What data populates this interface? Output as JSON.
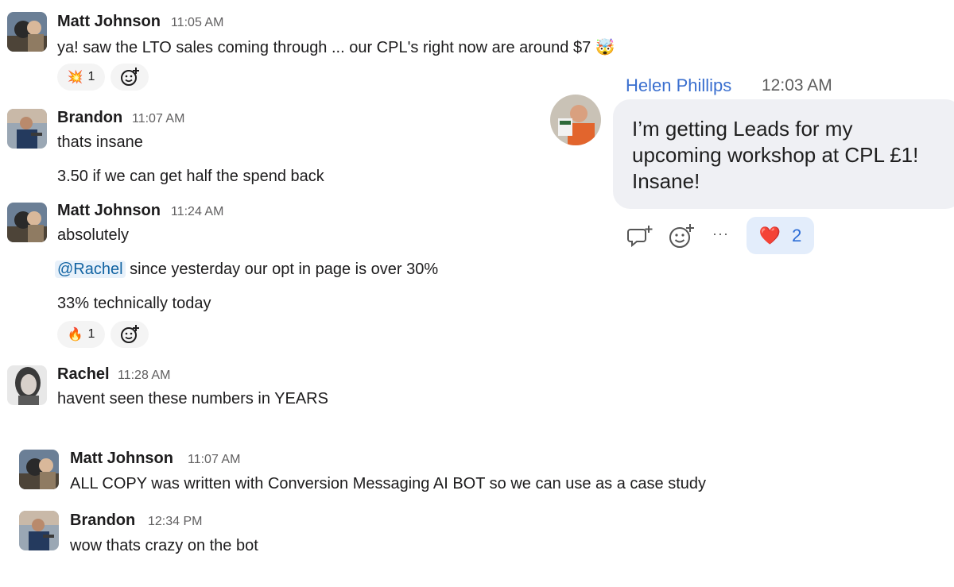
{
  "messages": [
    {
      "author": "Matt Johnson",
      "time": "11:05 AM",
      "lines": [
        "ya! saw the LTO sales coming through ... our CPL's right now are around $7"
      ],
      "reaction": {
        "emoji": "💥",
        "count": "1"
      }
    },
    {
      "author": "Brandon",
      "time": "11:07 AM",
      "lines": [
        "thats insane",
        "3.50 if we can get half the spend back"
      ]
    },
    {
      "author": "Matt Johnson",
      "time": "11:24 AM",
      "lines": [
        "absolutely",
        "since yesterday our opt in page is over 30%",
        "33% technically today"
      ],
      "mention": "@Rachel",
      "reaction": {
        "emoji": "🔥",
        "count": "1"
      }
    },
    {
      "author": "Rachel",
      "time": "11:28 AM",
      "lines": [
        "havent seen these numbers in YEARS"
      ]
    },
    {
      "author": "Matt Johnson",
      "time": "11:07 AM",
      "lines": [
        "ALL COPY was written with Conversion Messaging AI BOT so we can use as a case study"
      ]
    },
    {
      "author": "Brandon",
      "time": "12:34 PM",
      "lines": [
        "wow thats crazy on the bot"
      ]
    }
  ],
  "first_message_trailing_emoji": "🤯",
  "helen": {
    "author": "Helen Phillips",
    "time": "12:03 AM",
    "lines": [
      "I’m getting Leads for my",
      "upcoming workshop at CPL £1!",
      "Insane!"
    ],
    "more": "···",
    "reaction": {
      "emoji": "❤️",
      "count": "2"
    }
  },
  "icons": {
    "add_reaction": "add-reaction-icon",
    "reply": "reply-thread-icon",
    "more": "more-actions-icon"
  }
}
